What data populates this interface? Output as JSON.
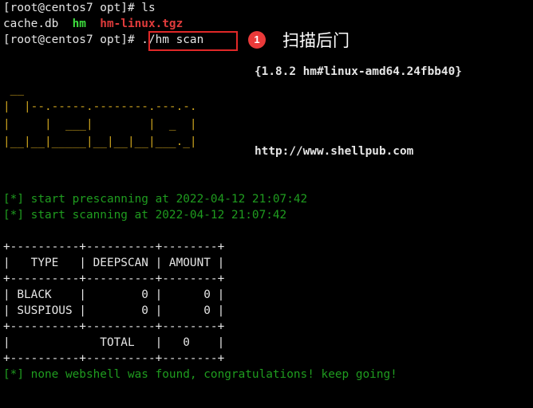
{
  "terminal": {
    "prompt_1": "[root@centos7 opt]# ",
    "cmd_1": "ls",
    "ls_output": {
      "file_1": "cache.db",
      "file_2": "hm",
      "file_3": "hm-linux.tgz"
    },
    "prompt_2": "[root@centos7 opt]# ",
    "cmd_2": "./hm scan",
    "version": "{1.8.2 hm#linux-amd64.24fbb40}",
    "ascii_logo": " __\n|  |--.-----.--------.---.-.\n|     |  ___|        |  _  |\n|__|__|_____|__|__|__|___._|",
    "url": "http://www.shellpub.com",
    "log_1": "[*] start prescanning at 2022-04-12 21:07:42",
    "log_2": "[*] start scanning at 2022-04-12 21:07:42",
    "table": {
      "border": "+----------+----------+--------+",
      "header": "|   TYPE   | DEEPSCAN | AMOUNT |",
      "row_black": "| BLACK    |        0 |      0 |",
      "row_suspious": "| SUSPIOUS |        0 |      0 |",
      "row_total": "|             TOTAL   |   0    |"
    },
    "final_message": "[*] none webshell was found, congratulations! keep going!"
  },
  "annotation": {
    "badge_number": "1",
    "text": "扫描后门",
    "box_color": "#e02828",
    "badge_color": "#ea3a3a"
  },
  "colors": {
    "background": "#000000",
    "foreground": "#e5e5e5",
    "log_green": "#1f9c1f",
    "dir_green": "#3ddc3d",
    "archive_red": "#e03b3b",
    "logo_yellow": "#c9a11e"
  }
}
